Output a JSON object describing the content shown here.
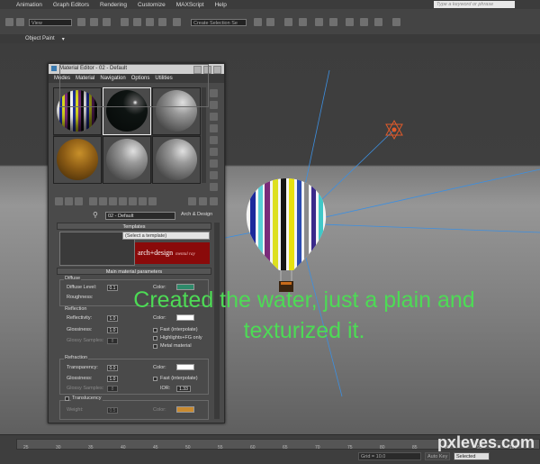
{
  "app": {
    "menus": [
      "Animation",
      "Graph Editors",
      "Rendering",
      "Customize",
      "MAXScript",
      "Help"
    ],
    "search_placeholder": "Type a keyword or phrase",
    "toolbar": {
      "view_combo": "View",
      "selection_set_combo": "Create Selection Se"
    },
    "subbar_label": "Object Paint"
  },
  "material_editor": {
    "title": "Material Editor - 02 - Default",
    "menus": [
      "Modes",
      "Material",
      "Navigation",
      "Options",
      "Utilities"
    ],
    "material_name": "02 - Default",
    "material_type": "Arch & Design",
    "templates": {
      "header": "Templates",
      "select_placeholder": "(Select a template)",
      "logo_text": "arch+design",
      "logo_subtext": "mental ray"
    },
    "main_params": {
      "header": "Main material parameters",
      "diffuse": {
        "group": "Diffuse",
        "level_label": "Diffuse Level:",
        "level_value": "0.1",
        "roughness_label": "Roughness:",
        "color_label": "Color:",
        "color": "#2e8a6a"
      },
      "reflection": {
        "group": "Reflection",
        "reflectivity_label": "Reflectivity:",
        "reflectivity_value": "1.0",
        "glossiness_label": "Glossiness:",
        "glossiness_value": "1.0",
        "glossy_samples_label": "Glossy Samples:",
        "glossy_samples_value": "8",
        "color_label": "Color:",
        "color": "#ffffff",
        "fast_interp": "Fast (interpolate)",
        "highlights_fg": "Highlights+FG only",
        "metal_material": "Metal material"
      },
      "refraction": {
        "group": "Refraction",
        "transparency_label": "Transparency:",
        "transparency_value": "0.0",
        "glossiness_label": "Glossiness:",
        "glossiness_value": "1.0",
        "glossy_samples_label": "Glossy Samples:",
        "glossy_samples_value": "8",
        "color_label": "Color:",
        "color": "#ffffff",
        "fast_interp": "Fast (interpolate)",
        "ior_label": "IOR:",
        "ior_value": "1.33"
      },
      "translucency": {
        "label": "Translucency",
        "weight_label": "Weight:",
        "weight_value": "0.5",
        "color_label": "Color:",
        "color": "#c98a30"
      }
    }
  },
  "caption": {
    "line1": "Created the water, just a plain and",
    "line2": "texturized it.",
    "color": "#4ddb55"
  },
  "timeline": {
    "ticks": [
      "25",
      "30",
      "35",
      "40",
      "45",
      "50",
      "55",
      "60",
      "65",
      "70",
      "75",
      "80",
      "85",
      "90",
      "95",
      "100"
    ],
    "grid_label": "Grid = 10.0",
    "autokey_label": "Auto Key",
    "selected_label": "Selected"
  },
  "watermark": "pxleves.com"
}
